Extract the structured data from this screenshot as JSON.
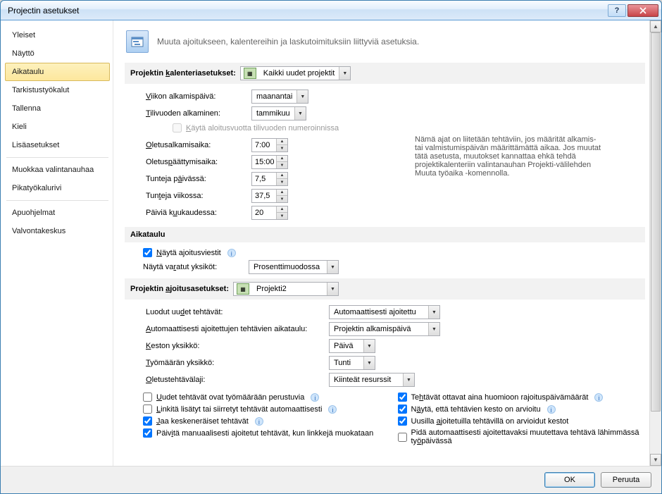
{
  "window": {
    "title": "Projectin asetukset"
  },
  "sidebar": {
    "items": [
      {
        "label": "Yleiset"
      },
      {
        "label": "Näyttö"
      },
      {
        "label": "Aikataulu",
        "selected": true
      },
      {
        "label": "Tarkistustyökalut"
      },
      {
        "label": "Tallenna"
      },
      {
        "label": "Kieli"
      },
      {
        "label": "Lisäasetukset"
      },
      {
        "label": "Muokkaa valintanauhaa"
      },
      {
        "label": "Pikatyökalurivi"
      },
      {
        "label": "Apuohjelmat"
      },
      {
        "label": "Valvontakeskus"
      }
    ]
  },
  "banner": {
    "text": "Muuta ajoitukseen, kalentereihin ja laskutoimituksiin liittyviä asetuksia."
  },
  "section1": {
    "title": "Projektin kalenteriasetukset:",
    "combo": "Kaikki uudet projektit",
    "weekstart_label": "Viikon alkamispäivä:",
    "weekstart_value": "maanantai",
    "fystart_label": "Tilivuoden alkaminen:",
    "fystart_value": "tammikuu",
    "usefiscal_label": "Käytä aloitusvuotta tilivuoden numeroinnissa",
    "defstart_label": "Oletusalkamisaika:",
    "defstart_value": "7:00",
    "defend_label": "Oletuspäättymisaika:",
    "defend_value": "15:00",
    "hrsday_label": "Tunteja päivässä:",
    "hrsday_value": "7,5",
    "hrsweek_label": "Tunteja viikossa:",
    "hrsweek_value": "37,5",
    "daysmonth_label": "Päiviä kuukaudessa:",
    "daysmonth_value": "20",
    "note": "Nämä ajat on liitetään tehtäviin, jos määrität alkamis- tai valmistumispäivän määrittämättä aikaa. Jos muutat tätä asetusta, muutokset kannattaa ehkä tehdä projektikalenteriin valintanauhan Projekti-välilehden Muuta työaika -komennolla."
  },
  "section2": {
    "title": "Aikataulu",
    "showmsg_label": "Näytä ajoitusviestit",
    "assigned_label": "Näytä varatut yksiköt:",
    "assigned_value": "Prosenttimuodossa"
  },
  "section3": {
    "title": "Projektin ajoitusasetukset:",
    "combo": "Projekti2",
    "new_label": "Luodut uudet tehtävät:",
    "new_value": "Automaattisesti ajoitettu",
    "auto_label": "Automaattisesti ajoitettujen tehtävien aikataulu:",
    "auto_value": "Projektin alkamispäivä",
    "durunit_label": "Keston yksikkö:",
    "durunit_value": "Päivä",
    "workunit_label": "Työmäärän yksikkö:",
    "workunit_value": "Tunti",
    "tasktype_label": "Oletustehtävälaji:",
    "tasktype_value": "Kiinteät resurssit",
    "chk_effort": "Uudet tehtävät ovat työmäärään perustuvia",
    "chk_autolink": "Linkitä lisätyt tai siirretyt tehtävät automaattisesti",
    "chk_split": "Jaa keskeneräiset tehtävät",
    "chk_update": "Päivitä manuaalisesti ajoitetut tehtävät, kun linkkejä muokataan",
    "chk_honor": "Tehtävät ottavat aina huomioon rajoituspäivämäärät",
    "chk_estdur": "Näytä, että tehtävien kesto on arvioitu",
    "chk_newest": "Uusilla ajoitetuilla tehtävillä on arvioidut kestot",
    "chk_keep": "Pidä automaattisesti ajoitettavaksi muutettava tehtävä lähimmässä työpäivässä"
  },
  "footer": {
    "ok": "OK",
    "cancel": "Peruuta"
  }
}
